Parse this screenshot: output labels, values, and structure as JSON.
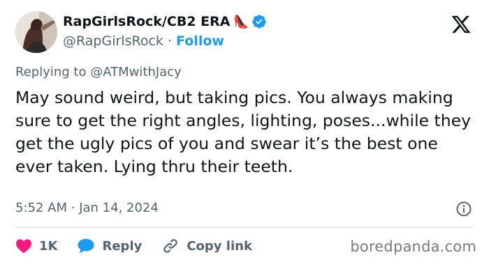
{
  "header": {
    "display_name": "RapGirlsRock/CB2 ERA",
    "heel_emoji": "👠",
    "handle": "@RapGirlsRock",
    "separator": "·",
    "follow_label": "Follow"
  },
  "reply": {
    "prefix": "Replying to",
    "mention": "@ATMwithJacy"
  },
  "tweet": {
    "text": "May sound weird, but taking pics. You always making sure to get the right angles, lighting, poses...while they get the ugly pics of you and swear it’s the best one ever taken. Lying thru their teeth."
  },
  "meta": {
    "time": "5:52 AM",
    "separator": "·",
    "date": "Jan 14, 2024"
  },
  "actions": {
    "likes": "1K",
    "reply_label": "Reply",
    "copy_link_label": "Copy link"
  },
  "watermark": "boredpanda.com",
  "colors": {
    "text": "#0f1419",
    "secondary": "#536471",
    "accent": "#1d9bf0",
    "like": "#f91880",
    "divider": "#cfd9de"
  }
}
